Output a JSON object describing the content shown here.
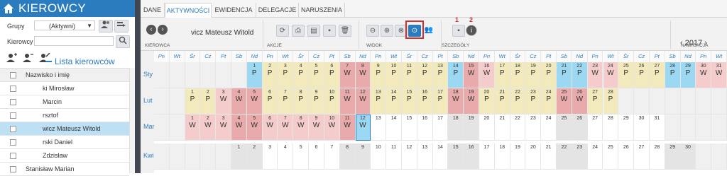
{
  "sidebar": {
    "title": "KIEROWCY",
    "grupy_label": "Grupy",
    "grupy_value": "(Aktywni)",
    "kierowcy_label": "Kierowcy",
    "lista_label": "Lista kierowców",
    "table_header": "Nazwisko i imię",
    "rows": [
      "ki Mirosław",
      "Marcin",
      "rsztof",
      "wicz Mateusz Witold",
      "rski Daniel",
      "Zdzisław",
      "Stanisław Marian"
    ]
  },
  "tabs": [
    "DANE",
    "AKTYWNOŚCI",
    "EWIDENCJA",
    "DELEGACJE",
    "NARUSZENIA"
  ],
  "toolbar": {
    "driver": "vicz Mateusz Witold",
    "group_kierowca": "KIEROWCA",
    "group_akcje": "AKCJE",
    "group_widok": "WIDOK",
    "group_szczegoly": "SZCZEGÓŁY",
    "group_nawigacja": "NAWIGACJA",
    "year": "2017",
    "red_num1": "1",
    "red_num2": "2"
  },
  "calendar": {
    "months": [
      "Sty",
      "Lut",
      "Mar",
      "Kwi"
    ],
    "day_headers": [
      "Pn",
      "Wt",
      "Śr",
      "Cz",
      "Pt",
      "Sb",
      "Nd",
      "Pn",
      "Wt",
      "Śr",
      "Cz",
      "Pt",
      "Sb",
      "Nd",
      "Pn",
      "Wt",
      "Śr",
      "Cz",
      "Pt",
      "Sb",
      "Nd",
      "Pn",
      "Wt",
      "Śr",
      "Cz",
      "Pt",
      "Sb",
      "Nd",
      "Pn",
      "Wt",
      "Śr",
      "Cz",
      "Pt",
      "Sb",
      "Nd",
      "Pn",
      "Wt"
    ],
    "rows": [
      {
        "offset": 6,
        "days": 31,
        "codes": [
          "P",
          "P",
          "P",
          "P",
          "P",
          "P",
          "W",
          "W",
          "P",
          "P",
          "P",
          "P",
          "P",
          "P",
          "W",
          "W",
          "P",
          "P",
          "P",
          "P",
          "P",
          "P",
          "W",
          "W",
          "P",
          "P",
          "P",
          "P",
          "P",
          "W",
          "W"
        ]
      },
      {
        "offset": 2,
        "days": 28,
        "codes": [
          "P",
          "P",
          "W",
          "W",
          "W",
          "P",
          "P",
          "P",
          "P",
          "P",
          "W",
          "W",
          "P",
          "P",
          "P",
          "P",
          "P",
          "W",
          "W",
          "P",
          "P",
          "P",
          "P",
          "P",
          "W",
          "W",
          "P",
          "P"
        ]
      },
      {
        "offset": 2,
        "days": 31,
        "codes": [
          "W",
          "W",
          "W",
          "W",
          "W",
          "W",
          "W",
          "W",
          "W",
          "W",
          "W",
          "W",
          "",
          "",
          "",
          "",
          "",
          "",
          "",
          "",
          "",
          "",
          "",
          "",
          "",
          "",
          "",
          "",
          "",
          "",
          ""
        ]
      },
      {
        "offset": 5,
        "days": 30,
        "codes": [
          "",
          "",
          "",
          "",
          "",
          "",
          "",
          "",
          "",
          "",
          "",
          "",
          "",
          "",
          "",
          "",
          "",
          "",
          "",
          "",
          "",
          "",
          "",
          "",
          "",
          "",
          "",
          "",
          "",
          "",
          ""
        ]
      }
    ]
  },
  "icons": {
    "home": "home-icon",
    "add_person": "add-person-icon",
    "remove_person": "remove-person-icon"
  }
}
